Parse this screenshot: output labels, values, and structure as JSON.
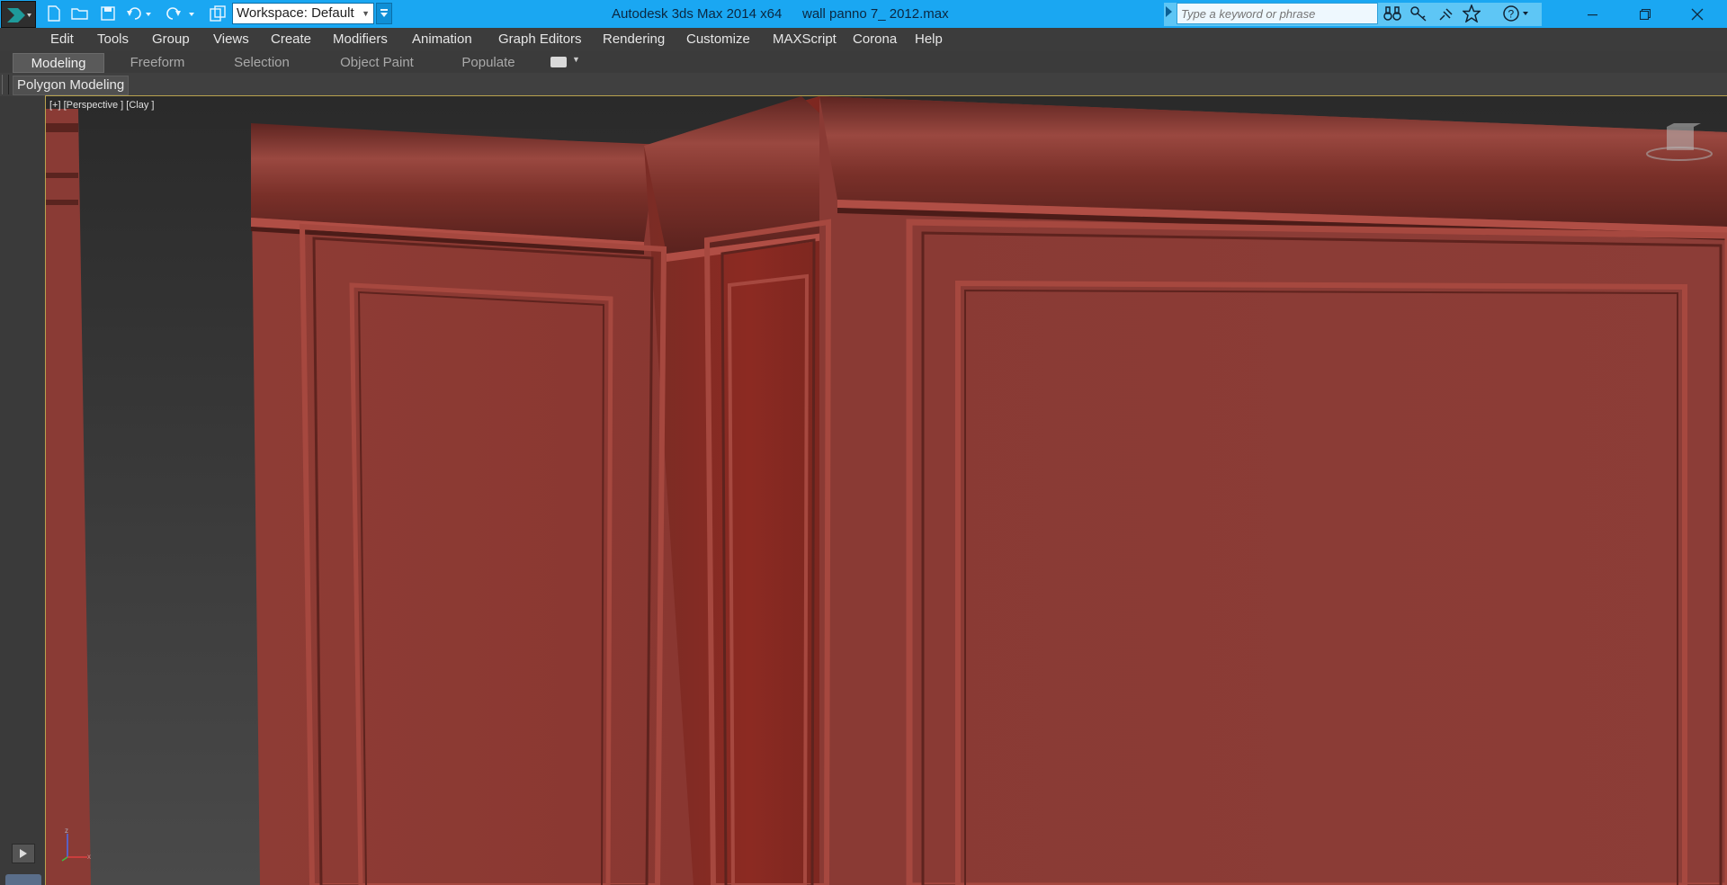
{
  "titlebar": {
    "workspace_label": "Workspace: Default",
    "app_name": "Autodesk 3ds Max  2014 x64",
    "file_name": "wall panno 7_ 2012.max",
    "search_placeholder": "Type a keyword or phrase",
    "bg_color": "#1aa7f2"
  },
  "menu": {
    "items": [
      "Edit",
      "Tools",
      "Group",
      "Views",
      "Create",
      "Modifiers",
      "Animation",
      "Graph Editors",
      "Rendering",
      "Customize",
      "MAXScript",
      "Corona",
      "Help"
    ]
  },
  "ribbon": {
    "tabs": [
      "Modeling",
      "Freeform",
      "Selection",
      "Object Paint",
      "Populate"
    ],
    "active_tab": "Modeling",
    "panel_label": "Polygon Modeling"
  },
  "viewport": {
    "label": "[+] [Perspective ] [Clay ]",
    "border_color": "#b8a24e",
    "model_color": "#8a3a33",
    "axis": {
      "z": "z",
      "x": "x"
    }
  },
  "icons": [
    "app-menu-icon",
    "new-file-icon",
    "open-file-icon",
    "save-icon",
    "undo-icon",
    "redo-icon",
    "project-folder-icon",
    "search-arrow-icon",
    "binoculars-icon",
    "key-icon",
    "star-icon",
    "help-icon",
    "minimize-icon",
    "restore-icon",
    "close-icon",
    "play-icon",
    "viewcube-icon"
  ]
}
